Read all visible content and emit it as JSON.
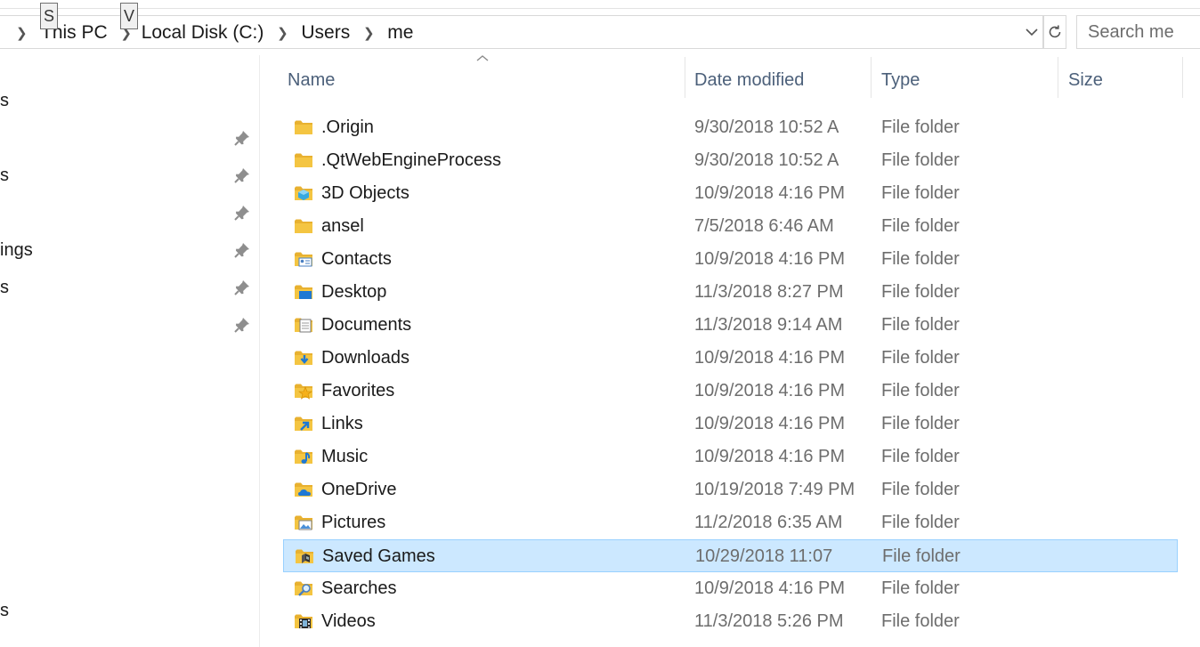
{
  "address_bar": {
    "crumbs": [
      "This PC",
      "Local Disk (C:)",
      "Users",
      "me"
    ],
    "keytips": [
      "S",
      "V"
    ]
  },
  "search": {
    "placeholder": "Search me"
  },
  "nav_pane": {
    "visible_fragments": [
      "s",
      "s",
      "ings",
      "s",
      "s"
    ],
    "pinned_count": 6
  },
  "columns": {
    "name": "Name",
    "date_modified": "Date modified",
    "type": "Type",
    "size": "Size",
    "sorted_by": "name",
    "sort_direction": "ascending"
  },
  "files": [
    {
      "name": ".Origin",
      "date": "9/30/2018 10:52 A",
      "type": "File folder",
      "icon": "folder-icon"
    },
    {
      "name": ".QtWebEngineProcess",
      "date": "9/30/2018 10:52 A",
      "type": "File folder",
      "icon": "folder-icon"
    },
    {
      "name": "3D Objects",
      "date": "10/9/2018 4:16 PM",
      "type": "File folder",
      "icon": "3d-objects-folder-icon"
    },
    {
      "name": "ansel",
      "date": "7/5/2018 6:46 AM",
      "type": "File folder",
      "icon": "folder-icon"
    },
    {
      "name": "Contacts",
      "date": "10/9/2018 4:16 PM",
      "type": "File folder",
      "icon": "contacts-folder-icon"
    },
    {
      "name": "Desktop",
      "date": "11/3/2018 8:27 PM",
      "type": "File folder",
      "icon": "desktop-folder-icon"
    },
    {
      "name": "Documents",
      "date": "11/3/2018 9:14 AM",
      "type": "File folder",
      "icon": "documents-folder-icon"
    },
    {
      "name": "Downloads",
      "date": "10/9/2018 4:16 PM",
      "type": "File folder",
      "icon": "downloads-folder-icon"
    },
    {
      "name": "Favorites",
      "date": "10/9/2018 4:16 PM",
      "type": "File folder",
      "icon": "favorites-folder-icon"
    },
    {
      "name": "Links",
      "date": "10/9/2018 4:16 PM",
      "type": "File folder",
      "icon": "links-folder-icon"
    },
    {
      "name": "Music",
      "date": "10/9/2018 4:16 PM",
      "type": "File folder",
      "icon": "music-folder-icon"
    },
    {
      "name": "OneDrive",
      "date": "10/19/2018 7:49 PM",
      "type": "File folder",
      "icon": "onedrive-folder-icon"
    },
    {
      "name": "Pictures",
      "date": "11/2/2018 6:35 AM",
      "type": "File folder",
      "icon": "pictures-folder-icon"
    },
    {
      "name": "Saved Games",
      "date": "10/29/2018 11:07",
      "type": "File folder",
      "icon": "saved-games-folder-icon",
      "selected": true
    },
    {
      "name": "Searches",
      "date": "10/9/2018 4:16 PM",
      "type": "File folder",
      "icon": "searches-folder-icon"
    },
    {
      "name": "Videos",
      "date": "11/3/2018 5:26 PM",
      "type": "File folder",
      "icon": "videos-folder-icon"
    }
  ],
  "colors": {
    "selection_fill": "#cce8ff",
    "selection_border": "#99d1ff",
    "folder_yellow": "#f4c542",
    "header_text": "#4c607a"
  }
}
